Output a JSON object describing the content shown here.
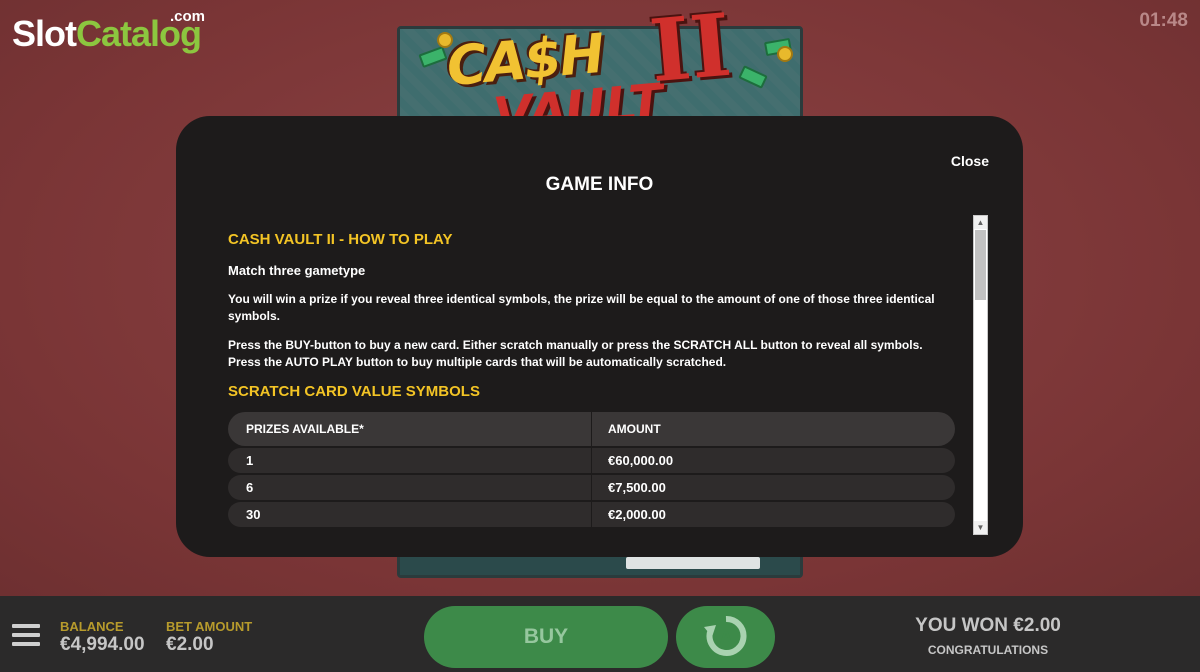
{
  "brand": {
    "slot": "Slot",
    "catalog": "Catalog",
    "dotcom": ".com"
  },
  "clock": "01:48",
  "game_logo": {
    "line1": "CA$H",
    "numeral": "II",
    "line2": "VAULT"
  },
  "modal": {
    "title": "GAME INFO",
    "close_label": "Close",
    "how_to_play_heading": "CASH VAULT II - HOW TO PLAY",
    "gametype": "Match three gametype",
    "para1": "You will win a prize if you reveal three identical symbols, the prize will be equal to the amount of one of those three identical symbols.",
    "para2": "Press the BUY-button to buy a new card. Either scratch manually or press the SCRATCH ALL button to reveal all symbols. Press the AUTO PLAY button to buy multiple cards that will be automatically scratched.",
    "symbols_heading": "SCRATCH CARD VALUE SYMBOLS",
    "table": {
      "headers": [
        "PRIZES AVAILABLE*",
        "AMOUNT"
      ],
      "rows": [
        {
          "prizes": "1",
          "amount": "€60,000.00"
        },
        {
          "prizes": "6",
          "amount": "€7,500.00"
        },
        {
          "prizes": "30",
          "amount": "€2,000.00"
        }
      ]
    }
  },
  "bottom_bar": {
    "balance_label": "BALANCE",
    "balance_value": "€4,994.00",
    "bet_label": "BET AMOUNT",
    "bet_value": "€2.00",
    "buy_label": "BUY",
    "won_text": "YOU WON €2.00",
    "congrats": "CONGRATULATIONS"
  },
  "colors": {
    "background": "#7e3a3b",
    "modal": "#1d1b1b",
    "heading_yellow": "#f3c425",
    "button_green": "#3d8a49",
    "brand_green": "#8cc63f"
  },
  "icons": {
    "menu": "hamburger-icon",
    "autoplay": "autoplay-icon",
    "scroll_up": "scroll-up-icon",
    "scroll_down": "scroll-down-icon"
  }
}
